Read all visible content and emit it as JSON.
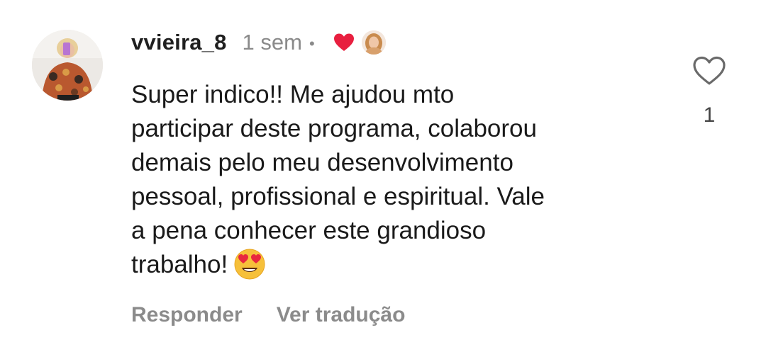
{
  "comment": {
    "username": "vvieira_8",
    "time": "1 sem",
    "separator": "•",
    "text": "Super indico!! Me ajudou mto\nparticipar deste programa, colaborou\ndemais pelo meu desenvolvimento\npessoal, profissional e espiritual. Vale\na pena conhecer este grandioso\ntrabalho!",
    "emoji": "heart-eyes-emoji",
    "liked_by_author": true,
    "like_count": "1",
    "actions": {
      "reply_label": "Responder",
      "translate_label": "Ver tradução"
    },
    "icons": {
      "liked_badge": "red-heart-icon",
      "like_button": "heart-outline-icon"
    },
    "colors": {
      "heart_red": "#e81f3f",
      "muted_text": "#8b8b8b",
      "emoji_yellow": "#f6c03a"
    }
  }
}
